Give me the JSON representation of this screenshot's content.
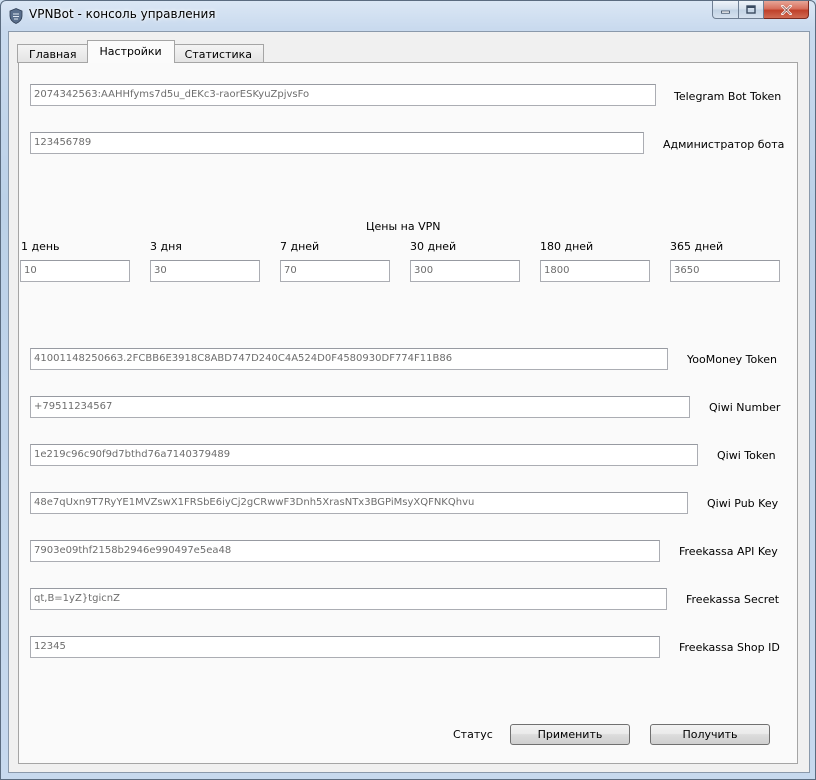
{
  "window": {
    "title": "VPNBot - консоль управления",
    "icon": "shield-icon"
  },
  "tabs": [
    {
      "label": "Главная",
      "active": false
    },
    {
      "label": "Настройки",
      "active": true
    },
    {
      "label": "Статистика",
      "active": false
    }
  ],
  "settings": {
    "telegram_bot_token": {
      "label": "Telegram Bot Token",
      "value": "2074342563:AAHHfyms7d5u_dEKc3-raorESKyuZpjvsFo"
    },
    "bot_admin": {
      "label": "Администратор бота",
      "value": "123456789"
    },
    "prices": {
      "title": "Цены на VPN",
      "items": [
        {
          "label": "1 день",
          "value": "10"
        },
        {
          "label": "3 дня",
          "value": "30"
        },
        {
          "label": "7 дней",
          "value": "70"
        },
        {
          "label": "30 дней",
          "value": "300"
        },
        {
          "label": "180 дней",
          "value": "1800"
        },
        {
          "label": "365 дней",
          "value": "3650"
        }
      ]
    },
    "yoomoney_token": {
      "label": "YooMoney Token",
      "value": "4100114825066З.2FCBB6E3918C8ABD747D240C4A524D0F4580930DF774F11B86"
    },
    "qiwi_number": {
      "label": "Qiwi Number",
      "value": "+79511234567"
    },
    "qiwi_token": {
      "label": "Qiwi Token",
      "value": "1e219c96c90f9d7bthd76a7140379489"
    },
    "qiwi_pub_key": {
      "label": "Qiwi Pub Key",
      "value": "48e7qUxn9T7RyYE1MVZswX1FRSbE6iyCj2gCRwwF3Dnh5XrasNTx3BGPiMsyXQFNKQhvu"
    },
    "freekassa_api_key": {
      "label": "Freekassa API Key",
      "value": "7903e09thf2158b2946e990497e5ea48"
    },
    "freekassa_secret": {
      "label": "Freekassa Secret",
      "value": "qt,B=1yZ}tgicnZ"
    },
    "freekassa_shop_id": {
      "label": "Freekassa Shop ID",
      "value": "12345"
    }
  },
  "footer": {
    "status_label": "Статус",
    "apply_label": "Применить",
    "get_label": "Получить"
  }
}
